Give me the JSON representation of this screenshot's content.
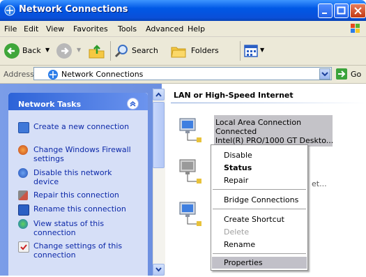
{
  "window": {
    "title": "Network Connections"
  },
  "menubar": {
    "items": [
      "File",
      "Edit",
      "View",
      "Favorites",
      "Tools",
      "Advanced",
      "Help"
    ]
  },
  "toolbar": {
    "back": "Back",
    "search": "Search",
    "folders": "Folders"
  },
  "address": {
    "label": "Address",
    "value": "Network Connections",
    "go": "Go"
  },
  "tasks": {
    "title": "Network Tasks",
    "items": [
      {
        "label": "Create a new connection",
        "icon": "new-connection-icon"
      },
      {
        "label": "Change Windows Firewall settings",
        "icon": "firewall-icon"
      },
      {
        "label": "Disable this network device",
        "icon": "disable-device-icon"
      },
      {
        "label": "Repair this connection",
        "icon": "repair-icon"
      },
      {
        "label": "Rename this connection",
        "icon": "rename-icon"
      },
      {
        "label": "View status of this connection",
        "icon": "status-icon"
      },
      {
        "label": "Change settings of this connection",
        "icon": "settings-icon"
      }
    ]
  },
  "section": {
    "title": "LAN or High-Speed Internet"
  },
  "connection": {
    "name": "Local Area Connection",
    "status": "Connected",
    "device": "Intel(R) PRO/1000 GT Deskto..."
  },
  "other_connection": {
    "device_truncated": "et..."
  },
  "context_menu": {
    "items": [
      "Disable",
      "Status",
      "Repair",
      "Bridge Connections",
      "Create Shortcut",
      "Delete",
      "Rename",
      "Properties"
    ]
  },
  "colors": {
    "title_bar": "#0058e6",
    "task_link": "#0c28a8",
    "menu_highlight": "#c1c0c8"
  }
}
